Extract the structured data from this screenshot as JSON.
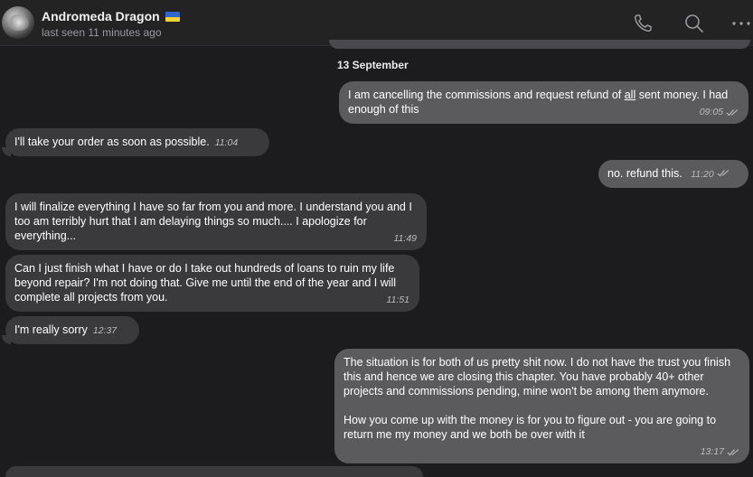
{
  "header": {
    "contact_name": "Andromeda Dragon",
    "last_seen": "last seen 11 minutes ago",
    "icons": [
      "phone-icon",
      "search-icon",
      "more-icon"
    ]
  },
  "chat": {
    "date_separator": "13 September",
    "messages": [
      {
        "direction": "outgoing",
        "text_before": "I am cancelling the commissions and request refund of ",
        "text_underlined": "all",
        "text_after": " sent money. I had enough of this",
        "time": "09:05",
        "read": true
      },
      {
        "direction": "incoming",
        "text": "I'll take your order as soon as possible.",
        "time": "11:04"
      },
      {
        "direction": "outgoing",
        "text": "no. refund this.",
        "time": "11:20",
        "read": true
      },
      {
        "direction": "incoming",
        "text": "I will finalize everything I have so far from you and more. I understand you and I too am terribly hurt that I am delaying things so much.... I apologize for everything...",
        "time": "11:49"
      },
      {
        "direction": "incoming",
        "text": "Can I just finish what I have or do I take out hundreds of loans to ruin my life beyond repair? I'm not doing that. Give me until the end of the year and I will complete all projects from you.",
        "time": "11:51"
      },
      {
        "direction": "incoming",
        "text": "I'm really sorry",
        "time": "12:37"
      },
      {
        "direction": "outgoing",
        "paragraph_1": "The situation is for both of us pretty shit now. I do not have the trust you finish this and hence we are closing this chapter. You have probably 40+ other projects and commissions pending, mine won't be among them anymore.",
        "paragraph_2": "How you come up with the money is for you to figure out - you are going to return me my money and we both be over with it",
        "time": "13:17",
        "read": true
      }
    ]
  },
  "colors": {
    "background": "#1c1c1e",
    "incoming_bubble": "#3a3a3c",
    "outgoing_bubble": "#5b5b5e",
    "header": "#232324"
  }
}
